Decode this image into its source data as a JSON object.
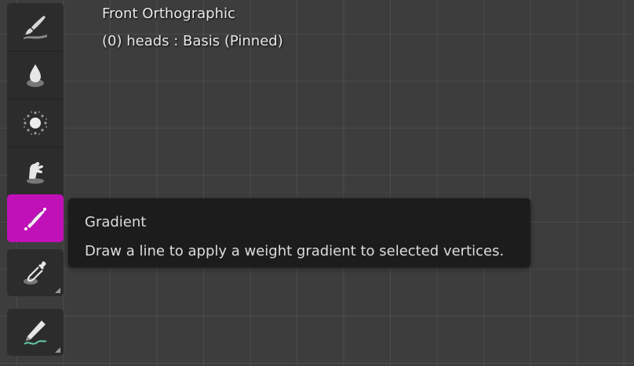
{
  "viewport": {
    "view_name": "Front Orthographic",
    "object_info": "(0) heads : Basis (Pinned)"
  },
  "toolbar": {
    "tools": [
      {
        "name": "Draw",
        "icon": "brush-icon",
        "active": false
      },
      {
        "name": "Blur",
        "icon": "droplet-icon",
        "active": false
      },
      {
        "name": "Average",
        "icon": "average-icon",
        "active": false
      },
      {
        "name": "Smear",
        "icon": "smear-icon",
        "active": false
      },
      {
        "name": "Gradient",
        "icon": "gradient-icon",
        "active": true
      },
      {
        "name": "Sample Weight",
        "icon": "eyedropper-icon",
        "active": false
      },
      {
        "name": "Annotate",
        "icon": "annotate-pencil-icon",
        "active": false
      }
    ],
    "accent_color": "#c010b7"
  },
  "tooltip": {
    "title": "Gradient",
    "description": "Draw a line to apply a weight gradient to selected vertices."
  }
}
